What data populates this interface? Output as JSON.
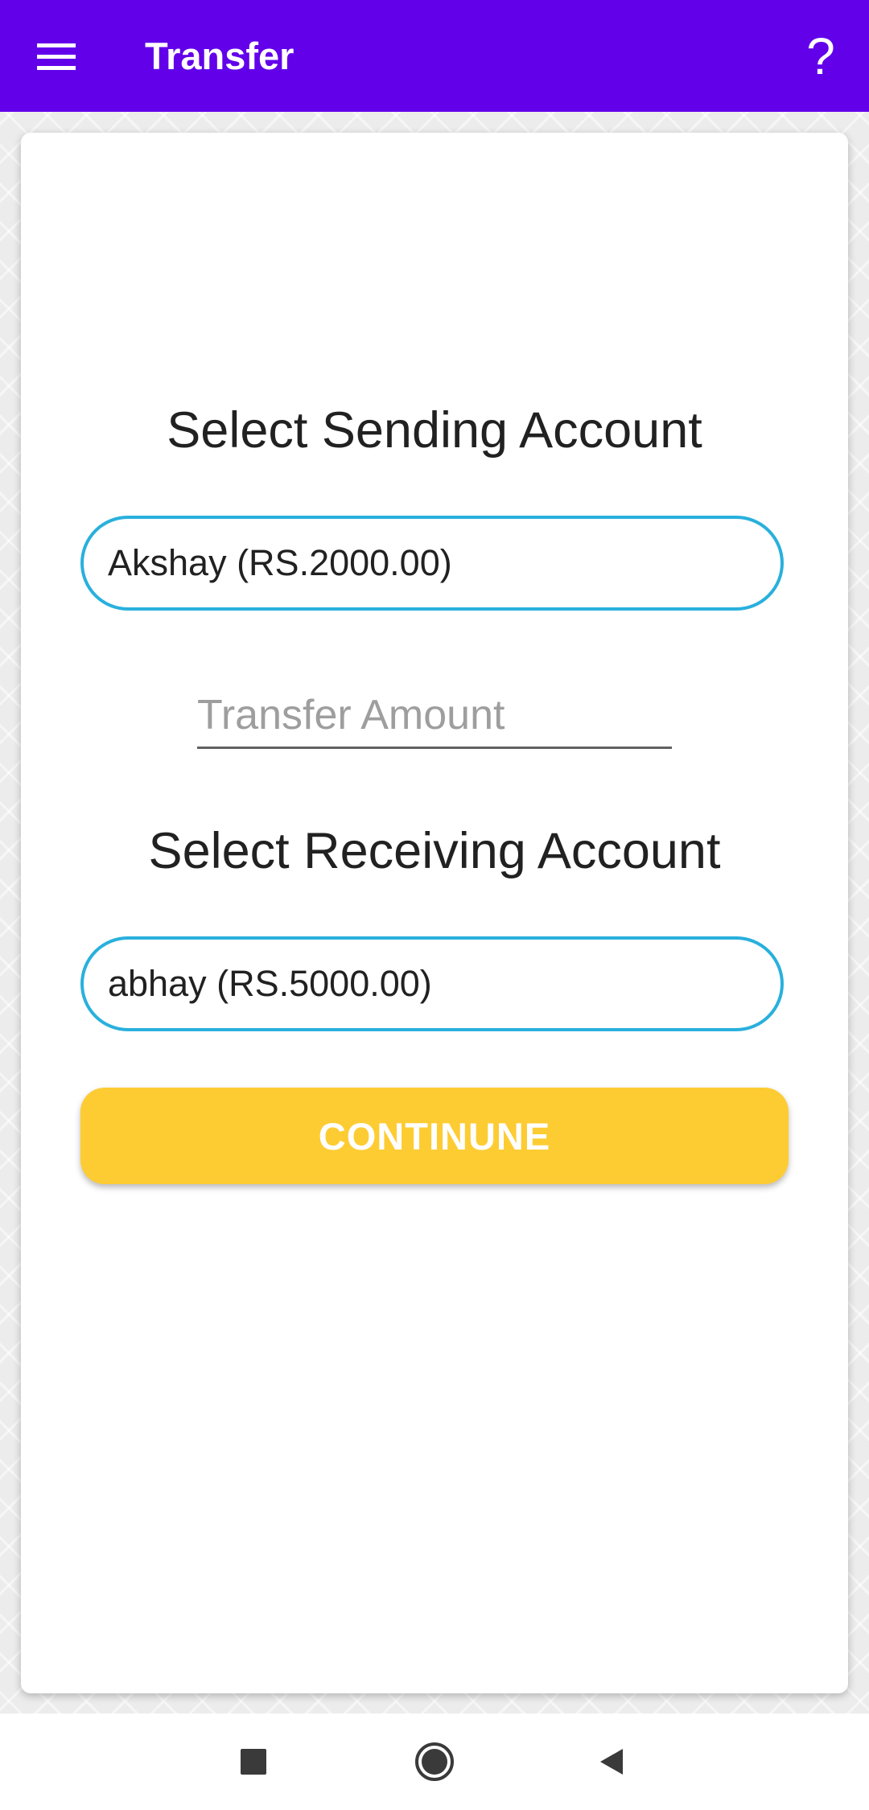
{
  "app_bar": {
    "title": "Transfer",
    "background_color": "#6200ea",
    "menu_icon": "hamburger-menu-icon",
    "help_label": "?"
  },
  "form": {
    "sending_title": "Select Sending Account",
    "sending_account": "Akshay (RS.2000.00)",
    "amount_placeholder": "Transfer Amount",
    "amount_value": "",
    "receiving_title": "Select Receiving Account",
    "receiving_account": "abhay (RS.5000.00)",
    "continue_label": "CONTINUNE",
    "select_border_color": "#29b0dd",
    "button_color": "#fdcc33"
  },
  "nav_bar": {
    "icons": [
      "recent-apps-icon",
      "home-icon",
      "back-icon"
    ]
  }
}
